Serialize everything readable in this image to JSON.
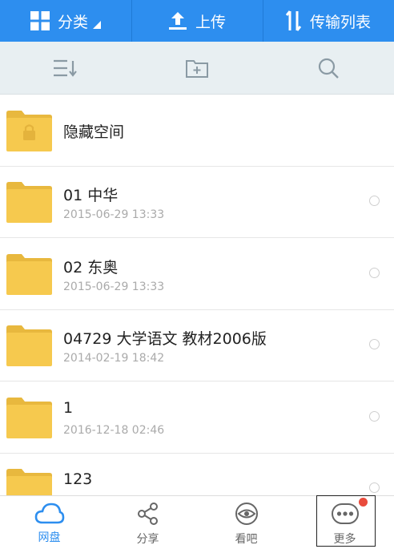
{
  "topbar": {
    "category_label": "分类",
    "upload_label": "上传",
    "transfer_label": "传输列表"
  },
  "toolbar": {
    "sort_icon": "sort-icon",
    "new_folder_icon": "new-folder-icon",
    "search_icon": "search-icon"
  },
  "files": [
    {
      "name": "隐藏空间",
      "date": "",
      "locked": true
    },
    {
      "name": "01 中华",
      "date": "2015-06-29  13:33"
    },
    {
      "name": "02 东奥",
      "date": "2015-06-29  13:33"
    },
    {
      "name": "04729 大学语文  教材2006版",
      "date": "2014-02-19  18:42"
    },
    {
      "name": "1",
      "date": "2016-12-18  02:46"
    },
    {
      "name": "123",
      "date": ""
    }
  ],
  "bottomnav": {
    "items": [
      {
        "label": "网盘",
        "icon": "cloud-icon",
        "active": true
      },
      {
        "label": "分享",
        "icon": "share-icon"
      },
      {
        "label": "看吧",
        "icon": "eye-icon"
      },
      {
        "label": "更多",
        "icon": "more-icon"
      }
    ]
  },
  "colors": {
    "primary": "#2d8eef",
    "folder": "#f6c94e",
    "badge": "#e94b3c"
  }
}
